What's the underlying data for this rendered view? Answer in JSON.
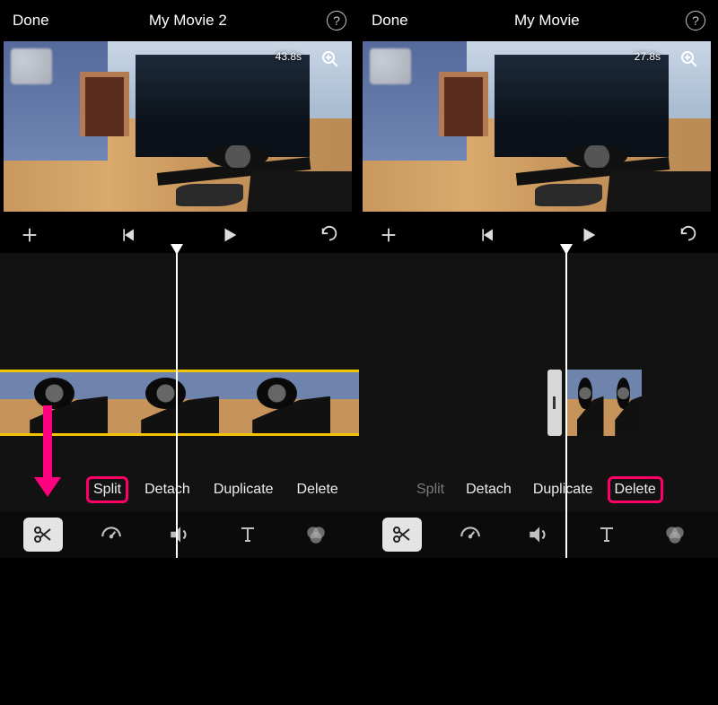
{
  "panels": [
    {
      "side": "left",
      "topbar": {
        "done": "Done",
        "title": "My Movie 2",
        "help": "?"
      },
      "preview": {
        "time": "43.8s"
      },
      "actions": [
        {
          "key": "split",
          "label": "Split",
          "highlight": true,
          "enabled": true
        },
        {
          "key": "detach",
          "label": "Detach",
          "highlight": false,
          "enabled": true
        },
        {
          "key": "duplicate",
          "label": "Duplicate",
          "highlight": false,
          "enabled": true
        },
        {
          "key": "delete",
          "label": "Delete",
          "highlight": false,
          "enabled": true
        }
      ],
      "toolbar_active": "scissors",
      "arrow_annotation": true
    },
    {
      "side": "right",
      "topbar": {
        "done": "Done",
        "title": "My Movie",
        "help": "?"
      },
      "preview": {
        "time": "27.8s"
      },
      "actions": [
        {
          "key": "split",
          "label": "Split",
          "highlight": false,
          "enabled": false
        },
        {
          "key": "detach",
          "label": "Detach",
          "highlight": false,
          "enabled": true
        },
        {
          "key": "duplicate",
          "label": "Duplicate",
          "highlight": false,
          "enabled": true
        },
        {
          "key": "delete",
          "label": "Delete",
          "highlight": true,
          "enabled": true
        }
      ],
      "toolbar_active": "scissors",
      "arrow_annotation": false
    }
  ],
  "icons": {
    "transport": [
      "add",
      "skip-back",
      "play",
      "undo"
    ],
    "toolbar": [
      "scissors",
      "speed",
      "volume",
      "text",
      "filters"
    ]
  }
}
